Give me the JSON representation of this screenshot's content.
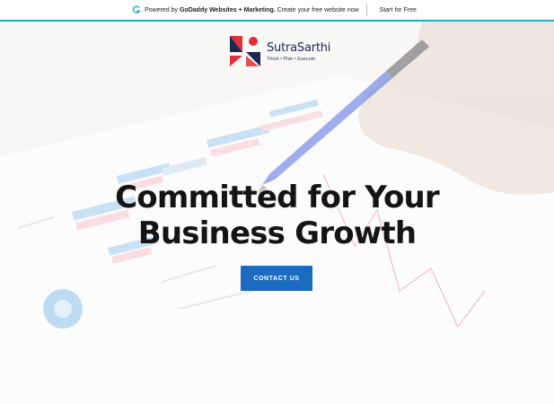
{
  "banner": {
    "text_prefix": "Powered by",
    "text_brand": "GoDaddy Websites + Marketing.",
    "text_suffix": "Create your free website now",
    "cta_label": "Start for Free"
  },
  "logo": {
    "name": "SutraSarthi",
    "tagline": "Think • Plan • Execute"
  },
  "hero": {
    "headline_line1": "Committed for Your",
    "headline_line2": "Business Growth",
    "cta_label": "CONTACT US"
  },
  "colors": {
    "accent_teal": "#1bb1b1",
    "button_blue": "#1b6cc0",
    "logo_red": "#e0303b",
    "logo_navy": "#1f2650"
  }
}
